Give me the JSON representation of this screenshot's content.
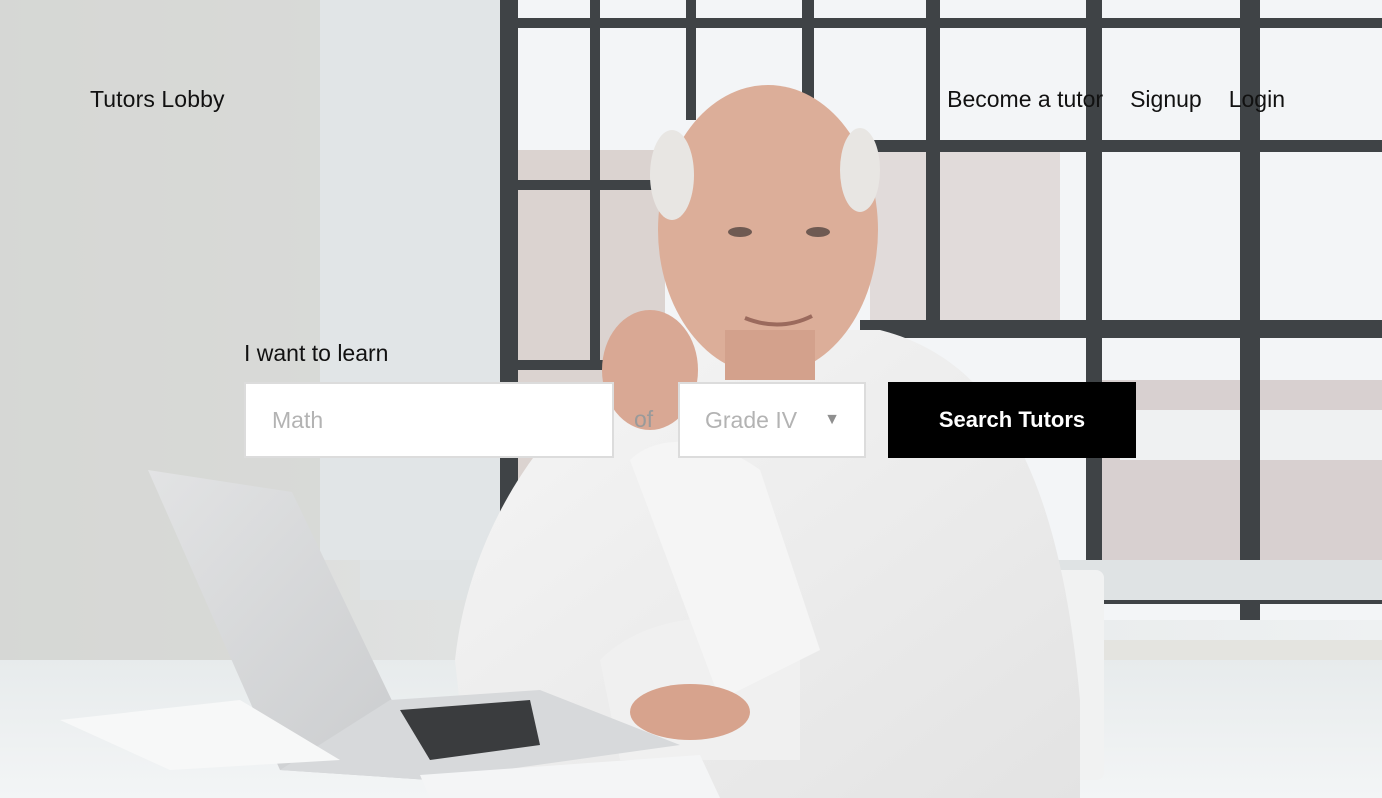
{
  "header": {
    "brand": "Tutors Lobby",
    "nav": {
      "become_tutor": "Become a tutor",
      "signup": "Signup",
      "login": "Login"
    }
  },
  "search": {
    "label": "I want to learn",
    "subject_placeholder": "Math",
    "subject_value": "",
    "connector": "of",
    "grade_value": "Grade IV",
    "grade_chevron": "▼",
    "submit_label": "Search Tutors"
  },
  "hero": {
    "image": "man-at-laptop-photo"
  },
  "colors": {
    "button_bg": "#000000",
    "button_text": "#ffffff",
    "text": "#111111",
    "placeholder": "#b3b3b3"
  }
}
